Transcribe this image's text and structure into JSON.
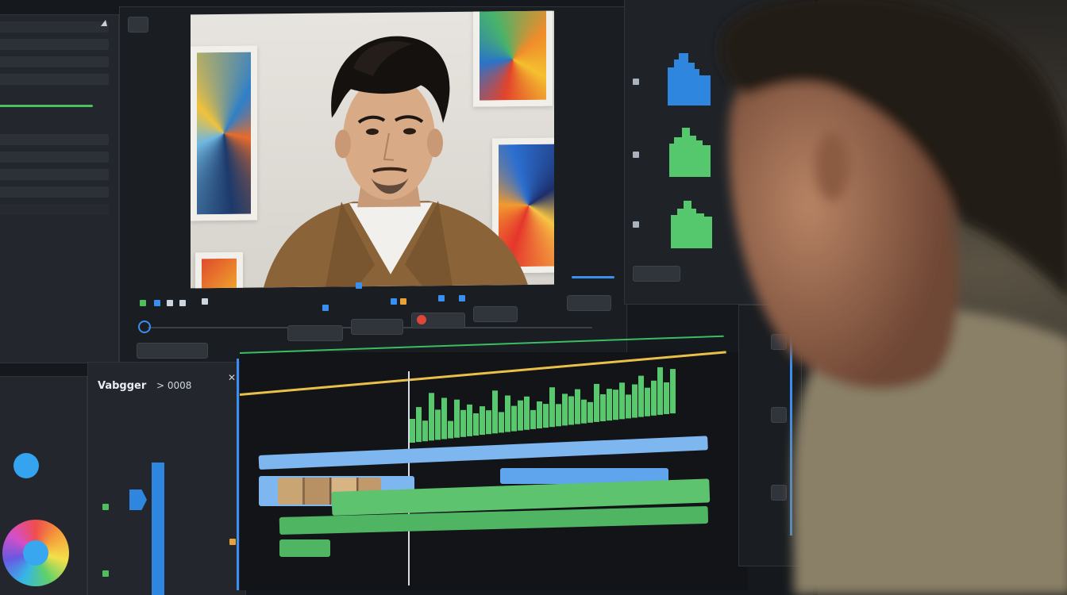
{
  "app": {
    "project_title": "Vabgger",
    "project_code": "> 0008"
  },
  "preview": {
    "subject": "man-in-brown-jacket-speaking"
  },
  "colors": {
    "accent_blue": "#3a8ff0",
    "accent_green": "#58c86e",
    "playhead": "#e8c04a",
    "record_red": "#e0453a",
    "panel_bg": "#23272d"
  },
  "icons": [
    "play-icon",
    "record-icon",
    "close-icon",
    "settings-icon",
    "arrow-icon",
    "color-wheel-icon"
  ]
}
